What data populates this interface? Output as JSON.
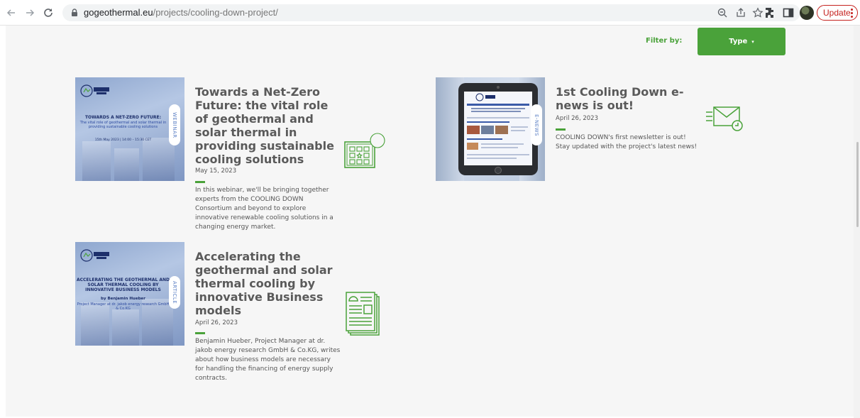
{
  "browser": {
    "url_host": "gogeothermal.eu",
    "url_path": "/projects/cooling-down-project/",
    "update_label": "Update"
  },
  "filter": {
    "label": "Filter by:",
    "type_label": "Type",
    "type_caret": "▾"
  },
  "cards": [
    {
      "title": "Towards a Net-Zero Future: the vital role of geothermal and solar thermal in providing sustainable cooling solutions",
      "date": "May 15, 2023",
      "description": "In this webinar, we'll be bringing together experts from the COOLING DOWN Consortium and beyond to explore innovative renewable cooling solutions in a changing energy market.",
      "tag": "WEBINAR",
      "thumb_title": "TOWARDS A NET-ZERO FUTURE:",
      "thumb_sub": "The vital role of geothermal and solar thermal in providing sustainable cooling solutions",
      "thumb_date": "15th May 2023 | 14:00 – 15:30 CET",
      "icon": "calendar-icon"
    },
    {
      "title": "1st Cooling Down e-news is out!",
      "date": "April 26, 2023",
      "description": "COOLING DOWN's first newsletter is out! Stay updated with the project's latest news!",
      "tag": "E-NEWS",
      "icon": "envelope-icon"
    },
    {
      "title": "Accelerating the geothermal and solar thermal cooling by innovative Business models",
      "date": "April 26, 2023",
      "description": "Benjamin Hueber, Project Manager at dr. jakob energy research GmbH & Co.KG, writes about how business models are necessary for handling the financing of energy supply contracts.",
      "tag": "ARTICLE",
      "thumb_title": "ACCELERATING THE GEOTHERMAL AND SOLAR THERMAL COOLING BY INNOVATIVE BUSINESS MODELS",
      "thumb_author": "by Benjamin Hueber",
      "thumb_sub": "Project Manager at dr. jakob energy research GmbH & Co.KG",
      "icon": "document-icon"
    }
  ],
  "colors": {
    "accent": "#4aa23a",
    "title": "#5a5a5a",
    "background": "#f6f6f6"
  }
}
